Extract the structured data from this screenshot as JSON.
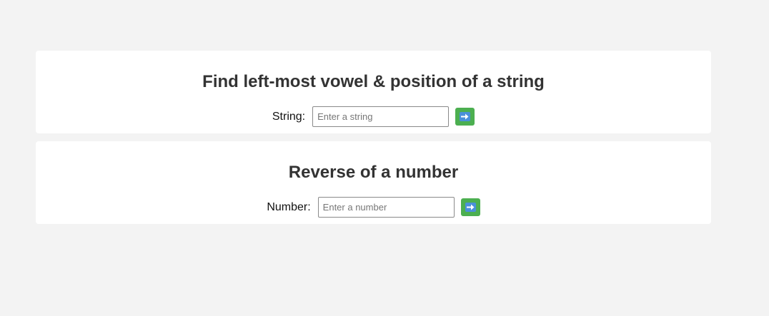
{
  "vowel_section": {
    "title": "Find left-most vowel & position of a string",
    "label": "String:",
    "placeholder": "Enter a string",
    "value": "",
    "button_icon": "right-arrow-icon"
  },
  "reverse_section": {
    "title": "Reverse of a number",
    "label": "Number:",
    "placeholder": "Enter a number",
    "value": "",
    "button_icon": "right-arrow-icon"
  },
  "colors": {
    "background": "#f3f3f3",
    "card": "#ffffff",
    "button": "#4caf50",
    "icon": "#4a90d9",
    "heading": "#333333"
  }
}
